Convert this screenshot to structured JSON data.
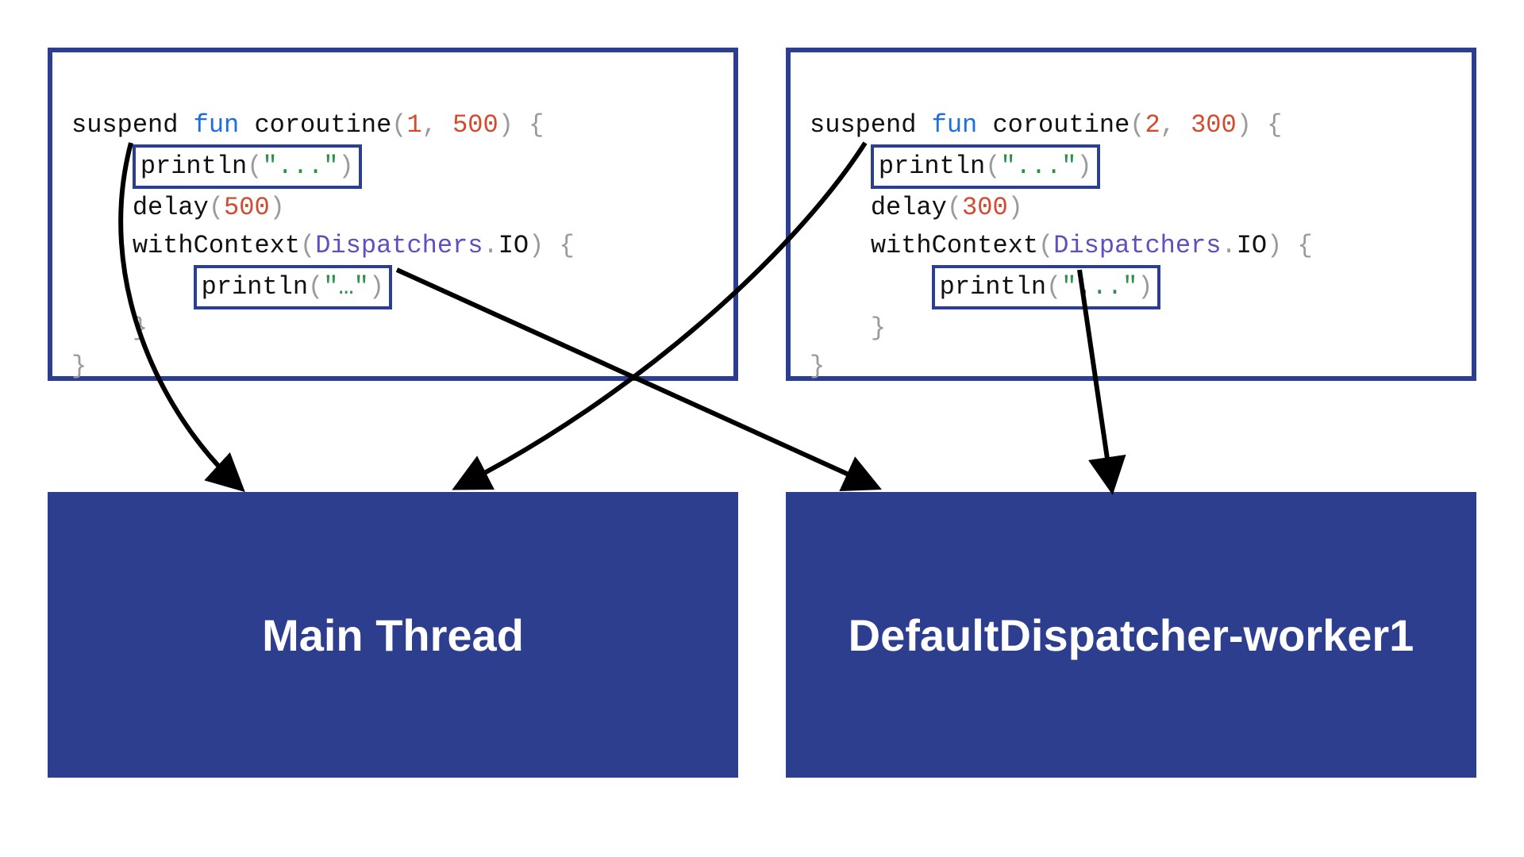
{
  "code1": {
    "sig_suspend": "suspend",
    "sig_fun": "fun",
    "sig_name": "coroutine",
    "sig_arg1": "1",
    "sig_arg2": "500",
    "println1_fn": "println",
    "println1_arg": "\"...\"",
    "delay_fn": "delay",
    "delay_arg": "500",
    "withctx_fn": "withContext",
    "withctx_disp": "Dispatchers",
    "withctx_io": "IO",
    "println2_fn": "println",
    "println2_arg": "\"…\""
  },
  "code2": {
    "sig_suspend": "suspend",
    "sig_fun": "fun",
    "sig_name": "coroutine",
    "sig_arg1": "2",
    "sig_arg2": "300",
    "println1_fn": "println",
    "println1_arg": "\"...\"",
    "delay_fn": "delay",
    "delay_arg": "300",
    "withctx_fn": "withContext",
    "withctx_disp": "Dispatchers",
    "withctx_io": "IO",
    "println2_fn": "println",
    "println2_arg": "\"...\""
  },
  "threads": {
    "main": "Main Thread",
    "worker": "DefaultDispatcher-worker1"
  },
  "colors": {
    "box_border": "#2e3e8f",
    "thread_bg": "#2e3e8f",
    "keyword_fun": "#1b6fe0",
    "number": "#d14b2e",
    "string": "#2e8f4a",
    "dispatcher": "#5f4fbf",
    "paren": "#9a9a9a"
  }
}
